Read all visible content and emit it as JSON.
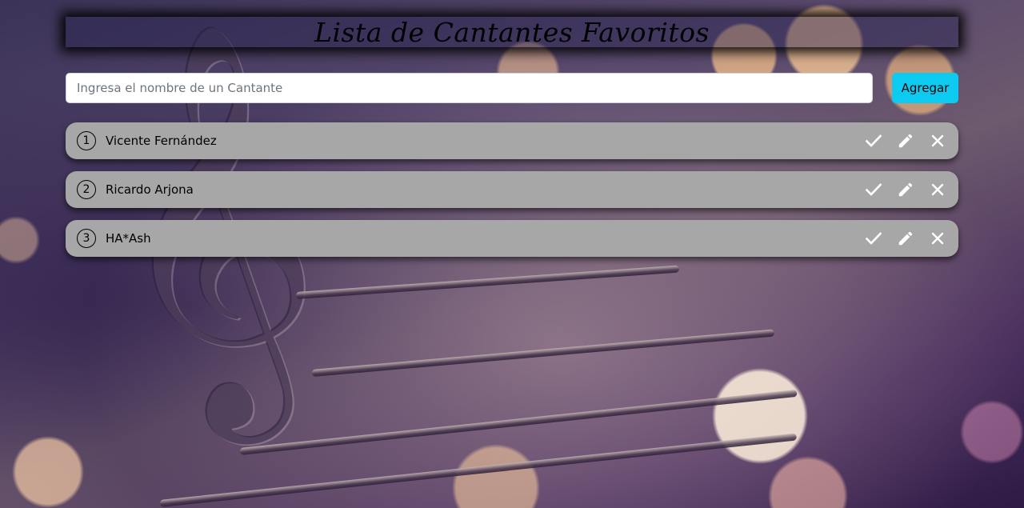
{
  "header": {
    "title": "Lista de Cantantes Favoritos"
  },
  "form": {
    "input_placeholder": "Ingresa el nombre de un Cantante",
    "input_value": "",
    "add_button_label": "Agregar"
  },
  "singers": [
    {
      "number": "1",
      "name": "Vicente Fernández"
    },
    {
      "number": "2",
      "name": "Ricardo Arjona"
    },
    {
      "number": "3",
      "name": "HA*Ash"
    }
  ],
  "item_actions": {
    "complete_icon": "check-icon",
    "edit_icon": "pencil-icon",
    "delete_icon": "close-icon"
  },
  "colors": {
    "accent_button": "#0dcaf0",
    "list_item_bg": "#a7a7a7",
    "icon_color": "#ffffff"
  }
}
